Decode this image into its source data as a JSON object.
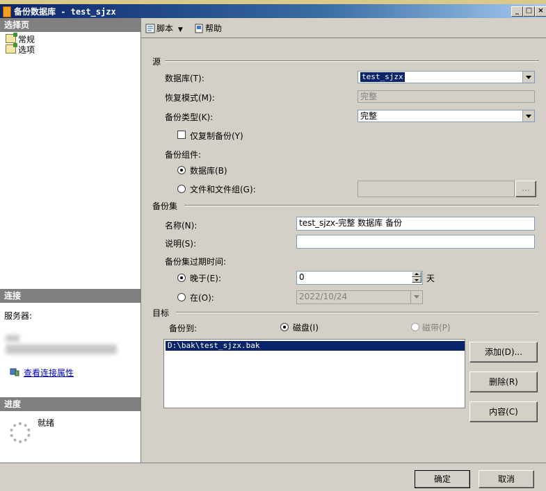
{
  "window": {
    "title": "备份数据库 - test_sjzx",
    "minimize": "_",
    "maximize": "□",
    "close": "×"
  },
  "left": {
    "select_page_header": "选择页",
    "pages": [
      {
        "label": "常规"
      },
      {
        "label": "选项"
      }
    ],
    "connection_header": "连接",
    "server_label": "服务器:",
    "view_connection_link": "查看连接属性",
    "progress_header": "进度",
    "progress_status": "就绪"
  },
  "toolbar": {
    "script_label": "脚本",
    "help_label": "帮助"
  },
  "source": {
    "group_label": "源",
    "database_label": "数据库(T):",
    "database_value": "test_sjzx",
    "recovery_label": "恢复模式(M):",
    "recovery_value": "完整",
    "backup_type_label": "备份类型(K):",
    "backup_type_value": "完整",
    "copy_only_label": "仅复制备份(Y)",
    "component_label": "备份组件:",
    "radio_database": "数据库(B)",
    "radio_files": "文件和文件组(G):",
    "browse_label": "..."
  },
  "backup_set": {
    "group_label": "备份集",
    "name_label": "名称(N):",
    "name_value": "test_sjzx-完整 数据库 备份",
    "desc_label": "说明(S):",
    "desc_value": "",
    "expire_label": "备份集过期时间:",
    "after_label": "晚于(E):",
    "after_value": "0",
    "days_unit": "天",
    "on_label": "在(O):",
    "on_value": "2022/10/24"
  },
  "destination": {
    "group_label": "目标",
    "backup_to_label": "备份到:",
    "disk_label": "磁盘(I)",
    "tape_label": "磁带(P)",
    "paths": [
      "D:\\bak\\test_sjzx.bak"
    ],
    "add_button": "添加(D)...",
    "remove_button": "删除(R)",
    "contents_button": "内容(C)"
  },
  "footer": {
    "ok_button": "确定",
    "cancel_button": "取消"
  }
}
